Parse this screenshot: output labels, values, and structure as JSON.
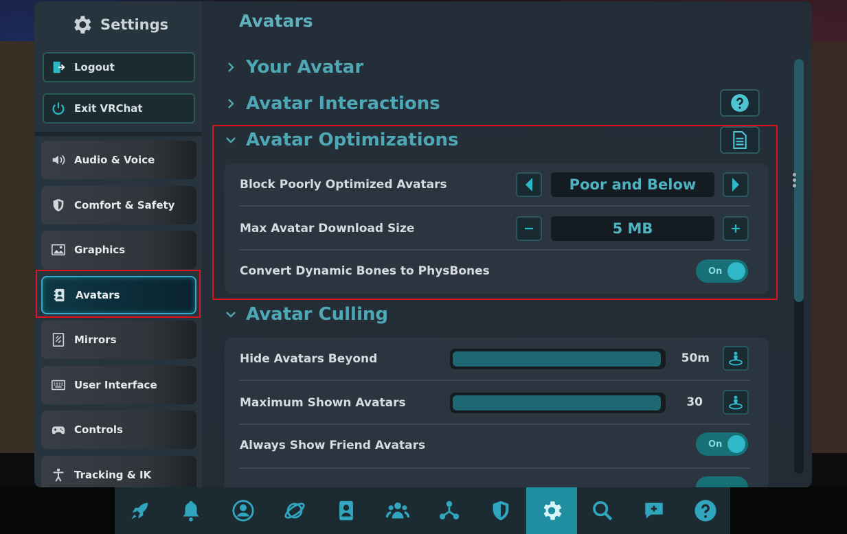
{
  "sidebar": {
    "title": "Settings",
    "logout_label": "Logout",
    "exit_label": "Exit VRChat",
    "items": [
      {
        "label": "Audio & Voice"
      },
      {
        "label": "Comfort & Safety"
      },
      {
        "label": "Graphics"
      },
      {
        "label": "Avatars",
        "active": true
      },
      {
        "label": "Mirrors"
      },
      {
        "label": "User Interface"
      },
      {
        "label": "Controls"
      },
      {
        "label": "Tracking & IK"
      }
    ]
  },
  "main": {
    "title": "Avatars",
    "sections": {
      "your_avatar": "Your Avatar",
      "interactions": "Avatar Interactions",
      "optimizations": "Avatar Optimizations",
      "culling": "Avatar Culling"
    },
    "optimizations": {
      "block_label": "Block Poorly Optimized Avatars",
      "block_value": "Poor and Below",
      "download_label": "Max Avatar Download Size",
      "download_value": "5 MB",
      "convert_label": "Convert Dynamic Bones to PhysBones",
      "convert_toggle": "On"
    },
    "culling": {
      "hide_label": "Hide Avatars Beyond",
      "hide_value": "50m",
      "hide_fill": 0.99,
      "max_label": "Maximum Shown Avatars",
      "max_value": "30",
      "max_fill": 0.99,
      "friends_label": "Always Show Friend Avatars",
      "friends_toggle": "On"
    }
  },
  "colors": {
    "accent": "#4ea7b4",
    "highlight": "#e0141c",
    "active_nav_border": "#36aac3"
  },
  "toolbar": {
    "icons": [
      "launch-icon",
      "notifications-icon",
      "profile-icon",
      "worlds-icon",
      "avatars-icon",
      "social-icon",
      "groups-icon",
      "safety-icon",
      "settings-icon",
      "search-icon",
      "chat-icon",
      "help-icon"
    ],
    "active": "settings-icon"
  }
}
